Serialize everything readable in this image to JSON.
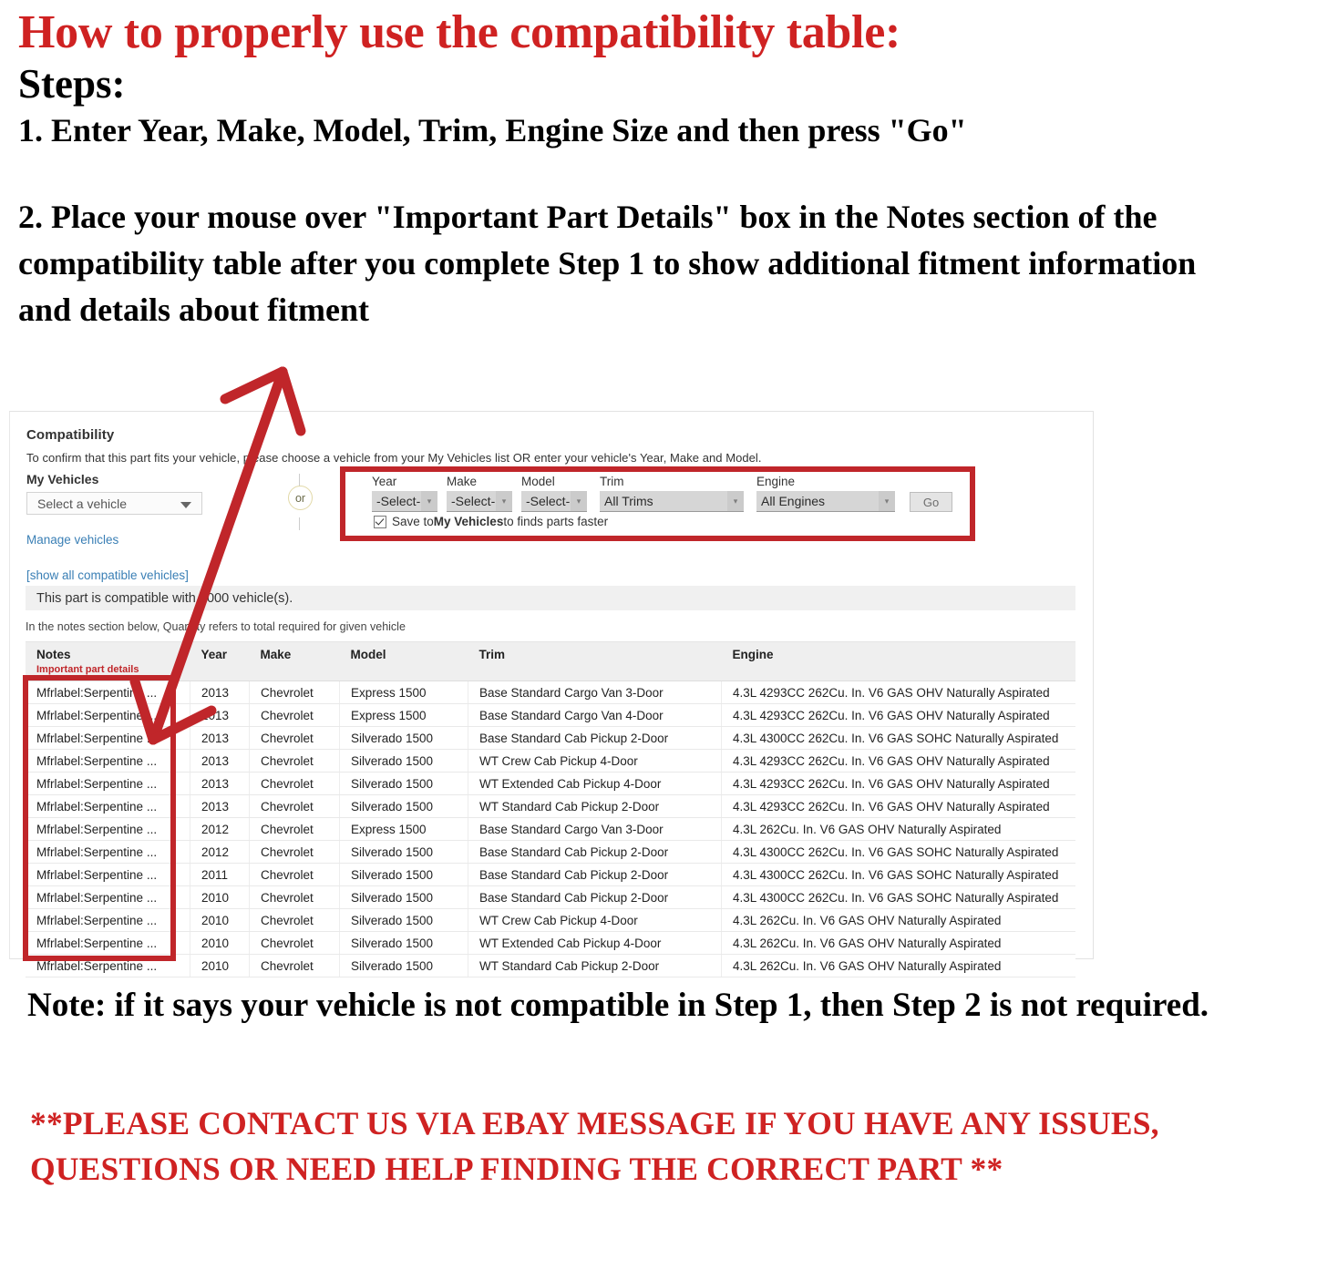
{
  "instructions": {
    "headline": "How to properly use the compatibility table:",
    "steps_label": "Steps:",
    "step1": "1. Enter Year, Make, Model, Trim, Engine Size and then press \"Go\"",
    "step2": "2. Place your mouse over \"Important Part Details\" box in the Notes section of the compatibility table after you complete Step 1 to show additional fitment information and details about fitment"
  },
  "compatibility": {
    "title": "Compatibility",
    "subtitle": "To confirm that this part fits your vehicle, please choose a vehicle from your My Vehicles list OR enter your vehicle's Year, Make and Model.",
    "my_vehicles": {
      "label": "My Vehicles",
      "select_value": "Select a vehicle",
      "manage_link": "Manage vehicles",
      "show_all_link": "[show all compatible vehicles]"
    },
    "divider_text": "or",
    "selectors": [
      {
        "caption": "Year",
        "value": "-Select-"
      },
      {
        "caption": "Make",
        "value": "-Select-"
      },
      {
        "caption": "Model",
        "value": "-Select-"
      },
      {
        "caption": "Trim",
        "value": "All Trims"
      },
      {
        "caption": "Engine",
        "value": "All Engines"
      }
    ],
    "go_button": "Go",
    "save_checkbox": {
      "checked": true,
      "prefix": "Save to ",
      "bold": "My Vehicles",
      "suffix": " to finds parts faster"
    },
    "count_bar": "This part is compatible with 1000 vehicle(s).",
    "notes_hint": "In the notes section below, Quantity refers to total required for given vehicle",
    "table": {
      "headers": [
        "Notes",
        "Year",
        "Make",
        "Model",
        "Trim",
        "Engine"
      ],
      "notes_subheader": "Important part details",
      "rows": [
        [
          "Mfrlabel:Serpentine ...",
          "2013",
          "Chevrolet",
          "Express 1500",
          "Base Standard Cargo Van 3-Door",
          "4.3L 4293CC 262Cu. In. V6 GAS OHV Naturally Aspirated"
        ],
        [
          "Mfrlabel:Serpentine ...",
          "2013",
          "Chevrolet",
          "Express 1500",
          "Base Standard Cargo Van 4-Door",
          "4.3L 4293CC 262Cu. In. V6 GAS OHV Naturally Aspirated"
        ],
        [
          "Mfrlabel:Serpentine ...",
          "2013",
          "Chevrolet",
          "Silverado 1500",
          "Base Standard Cab Pickup 2-Door",
          "4.3L 4300CC 262Cu. In. V6 GAS SOHC Naturally Aspirated"
        ],
        [
          "Mfrlabel:Serpentine ...",
          "2013",
          "Chevrolet",
          "Silverado 1500",
          "WT Crew Cab Pickup 4-Door",
          "4.3L 4293CC 262Cu. In. V6 GAS OHV Naturally Aspirated"
        ],
        [
          "Mfrlabel:Serpentine ...",
          "2013",
          "Chevrolet",
          "Silverado 1500",
          "WT Extended Cab Pickup 4-Door",
          "4.3L 4293CC 262Cu. In. V6 GAS OHV Naturally Aspirated"
        ],
        [
          "Mfrlabel:Serpentine ...",
          "2013",
          "Chevrolet",
          "Silverado 1500",
          "WT Standard Cab Pickup 2-Door",
          "4.3L 4293CC 262Cu. In. V6 GAS OHV Naturally Aspirated"
        ],
        [
          "Mfrlabel:Serpentine ...",
          "2012",
          "Chevrolet",
          "Express 1500",
          "Base Standard Cargo Van 3-Door",
          "4.3L 262Cu. In. V6 GAS OHV Naturally Aspirated"
        ],
        [
          "Mfrlabel:Serpentine ...",
          "2012",
          "Chevrolet",
          "Silverado 1500",
          "Base Standard Cab Pickup 2-Door",
          "4.3L 4300CC 262Cu. In. V6 GAS SOHC Naturally Aspirated"
        ],
        [
          "Mfrlabel:Serpentine ...",
          "2011",
          "Chevrolet",
          "Silverado 1500",
          "Base Standard Cab Pickup 2-Door",
          "4.3L 4300CC 262Cu. In. V6 GAS SOHC Naturally Aspirated"
        ],
        [
          "Mfrlabel:Serpentine ...",
          "2010",
          "Chevrolet",
          "Silverado 1500",
          "Base Standard Cab Pickup 2-Door",
          "4.3L 4300CC 262Cu. In. V6 GAS SOHC Naturally Aspirated"
        ],
        [
          "Mfrlabel:Serpentine ...",
          "2010",
          "Chevrolet",
          "Silverado 1500",
          "WT Crew Cab Pickup 4-Door",
          "4.3L 262Cu. In. V6 GAS OHV Naturally Aspirated"
        ],
        [
          "Mfrlabel:Serpentine ...",
          "2010",
          "Chevrolet",
          "Silverado 1500",
          "WT Extended Cab Pickup 4-Door",
          "4.3L 262Cu. In. V6 GAS OHV Naturally Aspirated"
        ],
        [
          "Mfrlabel:Serpentine ...",
          "2010",
          "Chevrolet",
          "Silverado 1500",
          "WT Standard Cab Pickup 2-Door",
          "4.3L 262Cu. In. V6 GAS OHV Naturally Aspirated"
        ]
      ]
    }
  },
  "footer": {
    "note": "Note: if it says your vehicle is not compatible in Step 1, then Step 2 is not required.",
    "contact": "**PLEASE CONTACT US VIA EBAY MESSAGE IF YOU HAVE ANY ISSUES, QUESTIONS OR NEED HELP FINDING THE CORRECT PART **"
  },
  "colors": {
    "headline_red": "#cf2222",
    "annotation_red": "#c0262a",
    "link_blue": "#3a7fb5"
  }
}
